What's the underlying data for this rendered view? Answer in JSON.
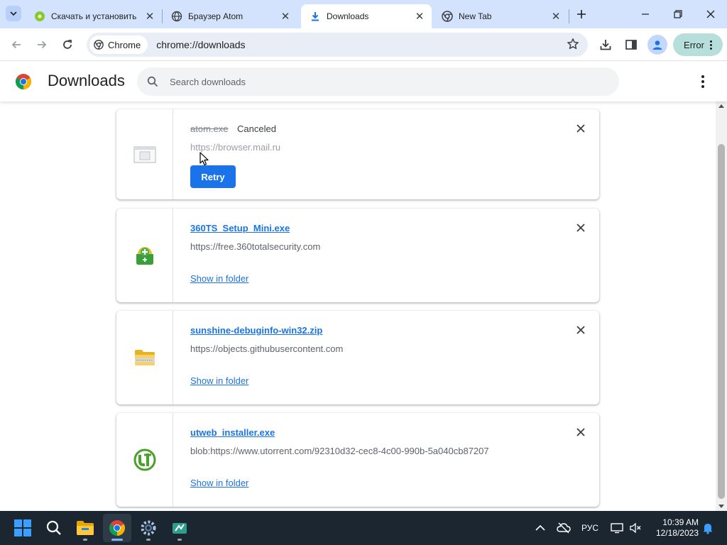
{
  "browser": {
    "tabs": [
      {
        "title": "Скачать и установить",
        "favicon": "atom-logo-icon",
        "active": false
      },
      {
        "title": "Браузер Atom",
        "favicon": "globe-icon",
        "active": false
      },
      {
        "title": "Downloads",
        "favicon": "download-icon",
        "active": true
      },
      {
        "title": "New Tab",
        "favicon": "chrome-icon",
        "active": false
      }
    ],
    "chip_label": "Chrome",
    "url": "chrome://downloads",
    "error_label": "Error"
  },
  "downloads": {
    "title": "Downloads",
    "search_placeholder": "Search downloads",
    "items": [
      {
        "filename": "atom.exe",
        "status": "Canceled",
        "source": "https://browser.mail.ru",
        "action": "Retry",
        "icon": "exe-file-icon"
      },
      {
        "filename": "360TS_Setup_Mini.exe",
        "source": "https://free.360totalsecurity.com",
        "action": "Show in folder",
        "icon": "360-total-security-icon"
      },
      {
        "filename": "sunshine-debuginfo-win32.zip",
        "source": "https://objects.githubusercontent.com",
        "action": "Show in folder",
        "icon": "zip-folder-icon"
      },
      {
        "filename": "utweb_installer.exe",
        "source": "blob:https://www.utorrent.com/92310d32-cec8-4c00-990b-5a040cb87207",
        "action": "Show in folder",
        "icon": "utorrent-icon"
      }
    ]
  },
  "taskbar": {
    "apps": [
      "start-icon",
      "search-icon",
      "file-explorer-icon",
      "chrome-icon",
      "settings-icon",
      "app-icon"
    ],
    "language": "РУС",
    "time": "10:39 AM",
    "date": "12/18/2023"
  },
  "colors": {
    "accent": "#1a73e8",
    "tabstrip": "#d3e3fd",
    "error_chip": "#b6dfdc",
    "taskbar": "#1b2630"
  }
}
